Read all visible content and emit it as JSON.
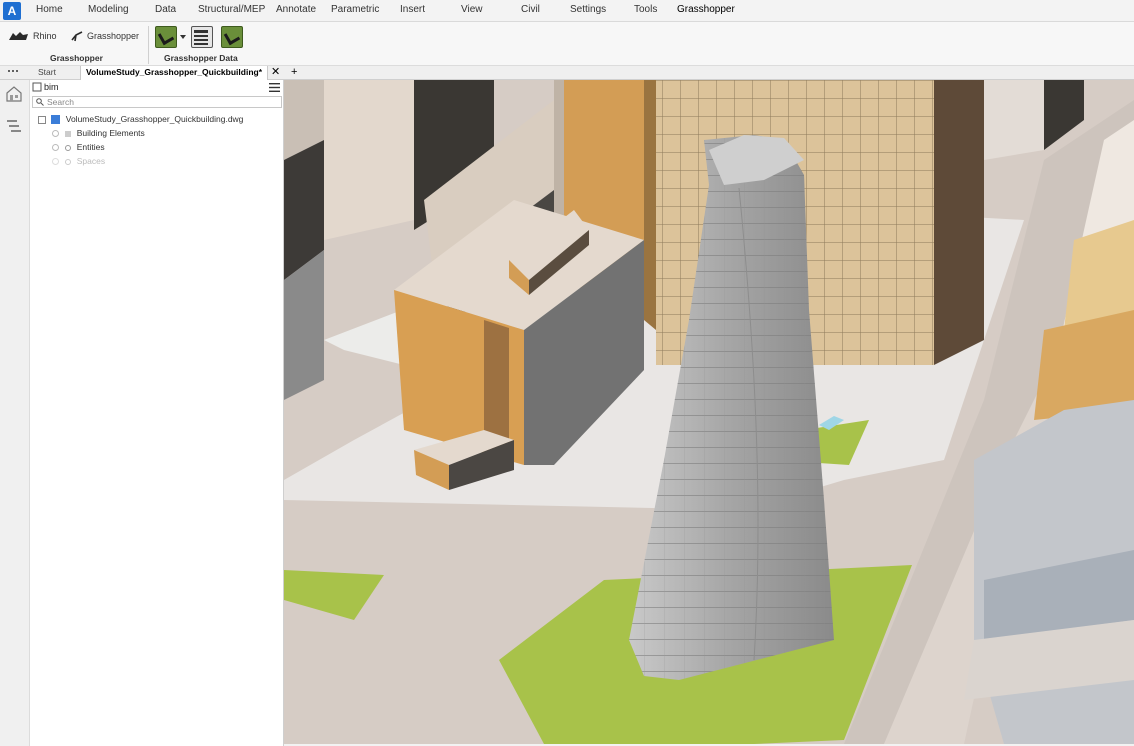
{
  "menu": {
    "items": [
      "Home",
      "Modeling",
      "Data",
      "Structural/MEP",
      "Annotate",
      "Parametric",
      "Insert",
      "View",
      "Civil",
      "Settings",
      "Tools",
      "Grasshopper"
    ]
  },
  "ribbon": {
    "rhino_label": "Rhino",
    "grasshopper_label": "Grasshopper",
    "group_grasshopper": "Grasshopper",
    "group_grasshopper_data": "Grasshopper Data"
  },
  "tabs": {
    "start": "Start",
    "document": "VolumeStudy_Grasshopper_Quickbuilding*",
    "close_glyph": "✕",
    "add_glyph": "+"
  },
  "panel": {
    "bim_label": "bim",
    "search_placeholder": "Search",
    "tree": {
      "file": "VolumeStudy_Grasshopper_Quickbuilding.dwg",
      "building_elements": "Building Elements",
      "entities": "Entities",
      "spaces": "Spaces"
    }
  },
  "icons": {
    "logo": "app-logo-icon",
    "rhino": "rhino-icon",
    "grasshopper": "grasshopper-icon",
    "menu": "hamburger-menu-icon",
    "search": "search-icon"
  },
  "colors": {
    "accent": "#1f6fd1",
    "grass_green": "#a8c24a",
    "building_orange": "#d8a65a",
    "tower_grey": "#a9a9a9"
  }
}
